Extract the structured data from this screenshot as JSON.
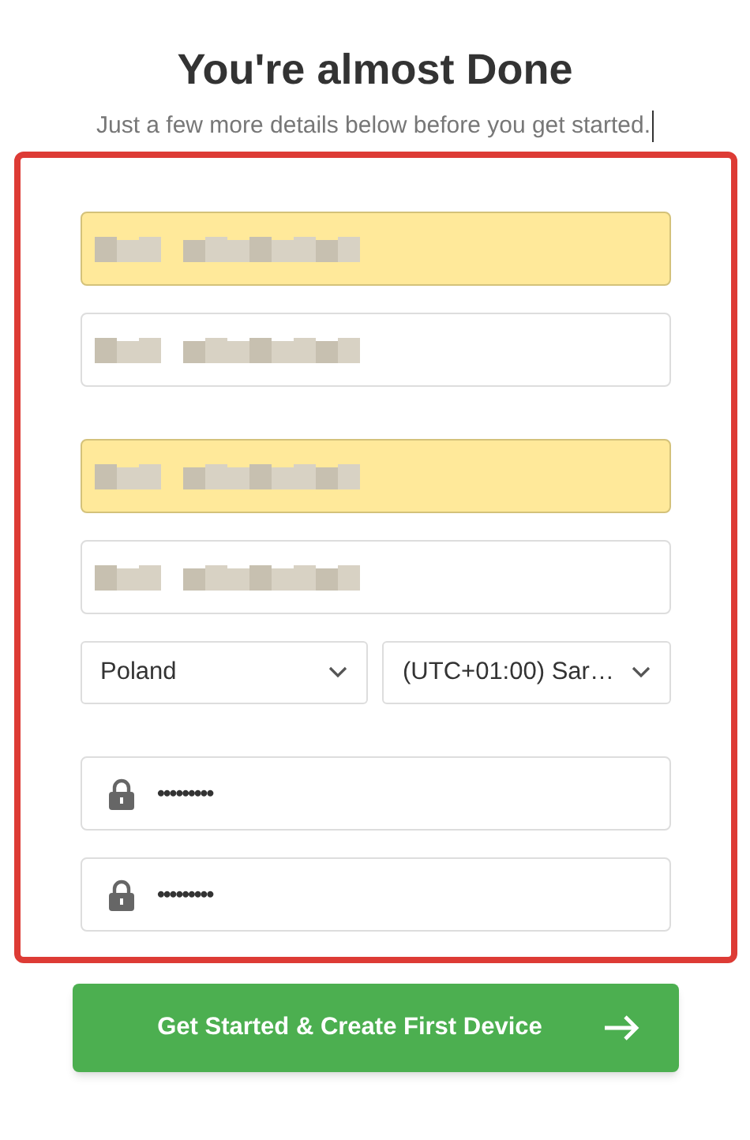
{
  "title": "You're almost Done",
  "subtitle": "Just a few more details below before you get started.",
  "fields": [
    {
      "kind": "text",
      "autofilled": true
    },
    {
      "kind": "text",
      "autofilled": false
    },
    {
      "kind": "gap"
    },
    {
      "kind": "text",
      "autofilled": true
    },
    {
      "kind": "text",
      "autofilled": false
    },
    {
      "kind": "selects",
      "options": [
        "Poland",
        "(UTC+01:00) Sar…"
      ]
    },
    {
      "kind": "gap"
    },
    {
      "kind": "password",
      "value": "•••••••••"
    },
    {
      "kind": "password",
      "value": "•••••••••"
    }
  ],
  "submit_button": {
    "label": "Get Started & Create First Device"
  }
}
